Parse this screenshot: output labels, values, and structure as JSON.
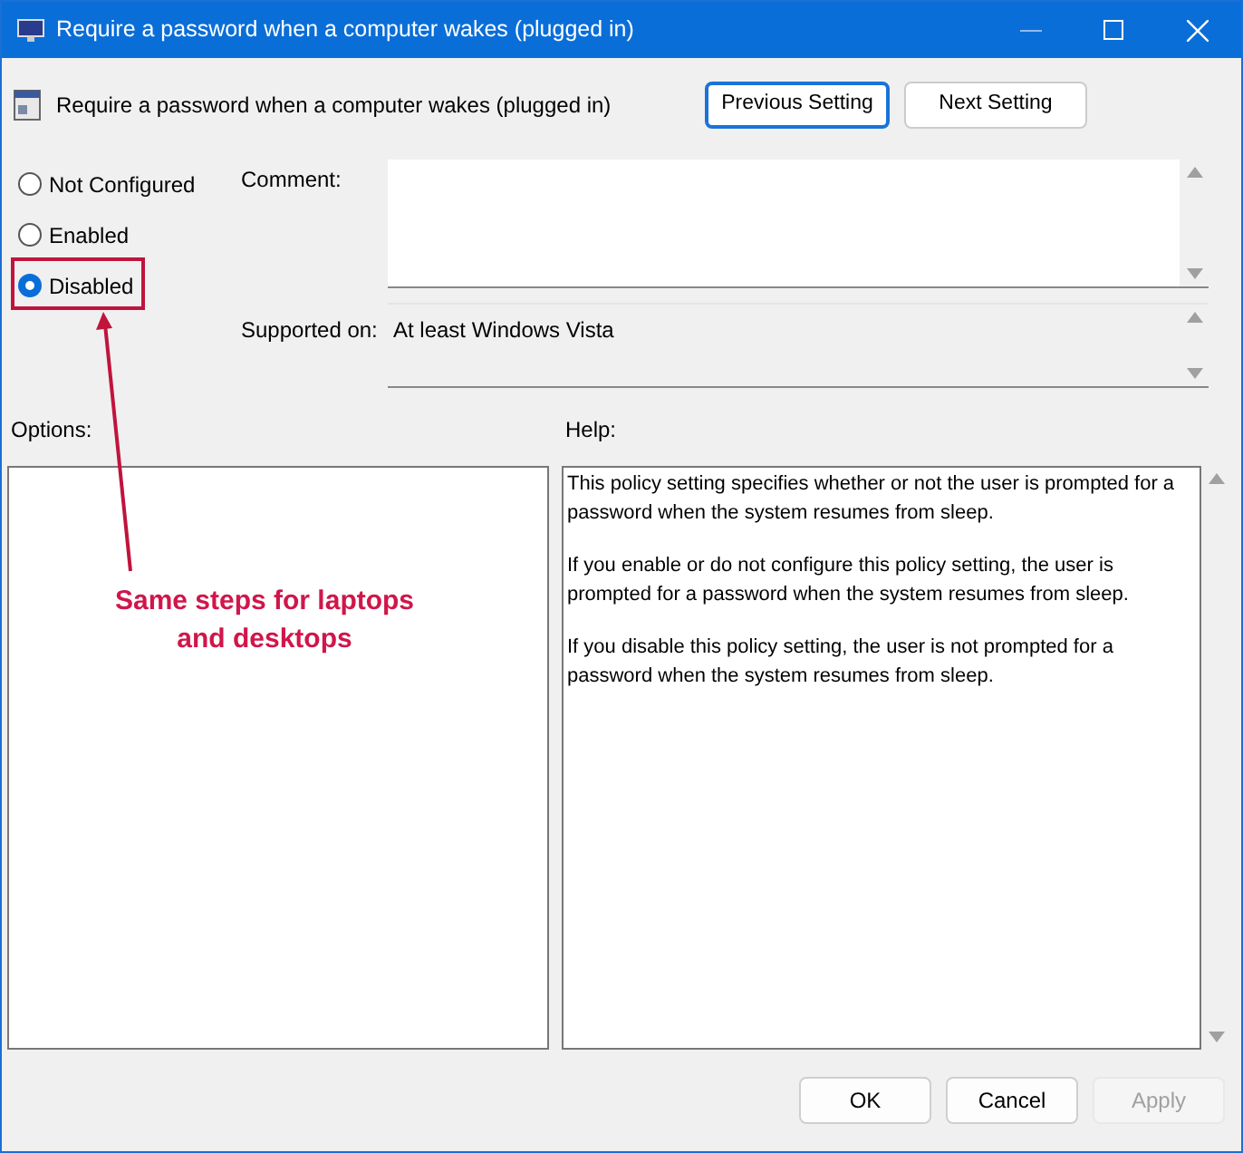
{
  "window": {
    "title": "Require a password when a computer wakes (plugged in)"
  },
  "header": {
    "title": "Require a password when a computer wakes (plugged in)",
    "buttons": [
      {
        "label": "Previous Setting",
        "focused": true
      },
      {
        "label": "Next Setting",
        "focused": false
      }
    ]
  },
  "radios": [
    {
      "label": "Not Configured",
      "selected": false
    },
    {
      "label": "Enabled",
      "selected": false
    },
    {
      "label": "Disabled",
      "selected": true
    }
  ],
  "comment_label": "Comment:",
  "supported_label": "Supported on:",
  "supported_value": "At least Windows Vista",
  "options_label": "Options:",
  "help_label": "Help:",
  "help_paragraphs": [
    "This policy setting specifies whether or not the user is prompted for a password when the system resumes from sleep.",
    "If you enable or do not configure this policy setting, the user is prompted for a password when the system resumes from sleep.",
    "If you disable this policy setting, the user is not prompted for a password when the system resumes from sleep."
  ],
  "annotation": "Same steps for laptops and desktops",
  "footer_buttons": [
    {
      "label": "OK",
      "disabled": false
    },
    {
      "label": "Cancel",
      "disabled": false
    },
    {
      "label": "Apply",
      "disabled": true
    }
  ]
}
